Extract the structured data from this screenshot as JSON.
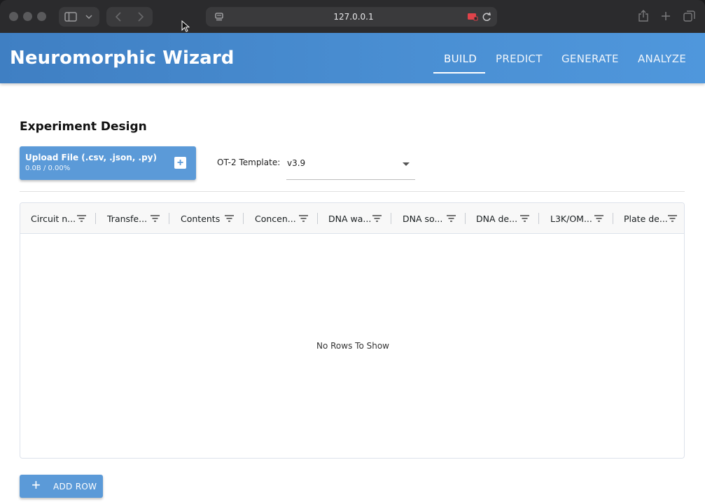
{
  "browser": {
    "url": "127.0.0.1",
    "icons": [
      "sidebar-icon",
      "chevron-down-icon",
      "back-icon",
      "forward-icon",
      "page-menu-icon",
      "recording-icon",
      "reload-icon",
      "share-icon",
      "new-tab-icon",
      "tabs-overview-icon"
    ]
  },
  "app": {
    "title": "Neuromorphic Wizard",
    "nav": [
      {
        "label": "BUILD",
        "active": true
      },
      {
        "label": "PREDICT",
        "active": false
      },
      {
        "label": "GENERATE",
        "active": false
      },
      {
        "label": "ANALYZE",
        "active": false
      }
    ]
  },
  "experiment": {
    "section_title": "Experiment Design",
    "upload": {
      "label": "Upload File (.csv, .json, .py)",
      "progress_text": "0.0B / 0.00%",
      "progress": 0
    },
    "template": {
      "label": "OT-2 Template:",
      "value": "v3.9"
    }
  },
  "grid": {
    "columns": [
      "Circuit n...",
      "Transfe...",
      "Contents",
      "Concen...",
      "DNA wa...",
      "DNA so...",
      "DNA de...",
      "L3K/OM...",
      "Plate de..."
    ],
    "empty_message": "No Rows To Show"
  },
  "actions": {
    "add_row_label": "ADD ROW"
  },
  "colors": {
    "appbar": "#4a8fd3",
    "button": "#5b9ad8"
  }
}
